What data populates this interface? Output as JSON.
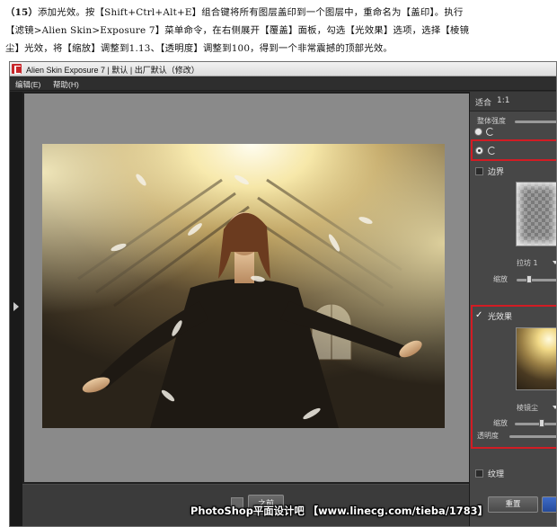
{
  "instruction": {
    "line1_step": "（15）",
    "line1": "添加光效。按【Shift+Ctrl+Alt+E】组合键将所有图层盖印到一个图层中，重命名为【盖印】。执行",
    "line2": "【滤镜>Alien Skin>Exposure 7】菜单命令，在右侧展开【覆盖】面板，勾选【光效果】选项，选择【棱镜",
    "line3": "尘】光效，将【缩放】调整到1.13、【透明度】调整到100，得到一个非常震撼的顶部光效。"
  },
  "window": {
    "title": "Alien Skin Exposure 7 | 默认 | 出厂默认（修改）"
  },
  "menu": {
    "items": [
      {
        "label": "编辑(E)"
      },
      {
        "label": "帮助(H)"
      }
    ]
  },
  "preview": {
    "before_button": "之前"
  },
  "panel": {
    "zoom_fit": "适合",
    "zoom_1_1": "1:1",
    "overall_strength": "整体强度",
    "border_label": "边界",
    "border_preset": "拉坊 1",
    "border_scale": "缩放",
    "light_label": "光效果",
    "light_checked": true,
    "light_preset": "棱镜尘",
    "light_scale": "缩放",
    "light_opacity": "透明度",
    "texture_label": "纹理",
    "reset_button": "重置"
  },
  "watermark": "PhotoShop平面设计吧 【www.linecg.com/tieba/1783】",
  "colors": {
    "highlight_red": "#d21c24",
    "window_dark": "#2b2b2b",
    "panel_gray": "#474747"
  }
}
